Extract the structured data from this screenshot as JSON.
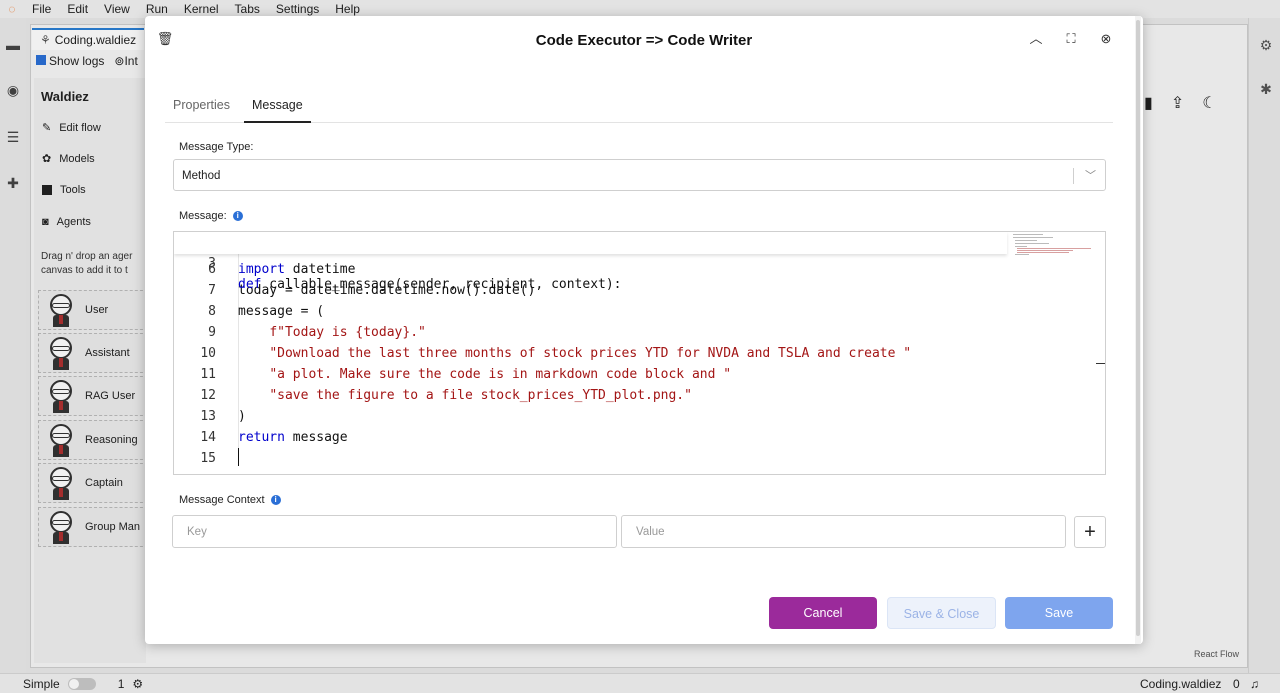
{
  "menubar": {
    "items": [
      "File",
      "Edit",
      "View",
      "Run",
      "Kernel",
      "Tabs",
      "Settings",
      "Help"
    ]
  },
  "left_bar_icons": [
    "folder-icon",
    "stop-circle-icon",
    "list-icon",
    "puzzle-icon"
  ],
  "right_bar_icons": [
    "gear-icon",
    "bug-icon"
  ],
  "doc": {
    "tab_label": "Coding.waldiez",
    "show_logs": "Show logs",
    "interrupt": "Int",
    "sidebar": {
      "title": "Waldiez",
      "nav": [
        {
          "label": "Edit flow",
          "icon": "edit-icon"
        },
        {
          "label": "Models",
          "icon": "openai-icon"
        },
        {
          "label": "Tools",
          "icon": "terminal-icon"
        },
        {
          "label": "Agents",
          "icon": "robot-icon"
        }
      ],
      "hint_line1": "Drag n' drop an ager",
      "hint_line2": "canvas to add it to t",
      "agents": [
        "User",
        "Assistant",
        "RAG User",
        "Reasoning",
        "Captain",
        "Group Man"
      ]
    },
    "react_flow": "React Flow"
  },
  "statusbar": {
    "mode": "Simple",
    "count": "1",
    "filename": "Coding.waldiez",
    "errors": "0"
  },
  "modal": {
    "title": "Code Executor => Code Writer",
    "tabs": [
      {
        "label": "Properties"
      },
      {
        "label": "Message"
      }
    ],
    "message_type_label": "Message Type:",
    "message_type_value": "Method",
    "message_label": "Message:",
    "code_header": {
      "num": "3",
      "text": "def callable_message(sender, recipient, context):"
    },
    "code_lines": [
      {
        "num": "6",
        "text": "    import datetime"
      },
      {
        "num": "7",
        "text": "    today = datetime.datetime.now().date()"
      },
      {
        "num": "8",
        "text": "    message = ("
      },
      {
        "num": "9",
        "text": "        f\"Today is {today}.\""
      },
      {
        "num": "10",
        "text": "        \"Download the last three months of stock prices YTD for NVDA and TSLA and create \""
      },
      {
        "num": "11",
        "text": "        \"a plot. Make sure the code is in markdown code block and \""
      },
      {
        "num": "12",
        "text": "        \"save the figure to a file stock_prices_YTD_plot.png.\""
      },
      {
        "num": "13",
        "text": "    )"
      },
      {
        "num": "14",
        "text": "    return message"
      },
      {
        "num": "15",
        "text": ""
      }
    ],
    "context_label": "Message Context",
    "key_placeholder": "Key",
    "value_placeholder": "Value",
    "add_label": "+",
    "buttons": {
      "cancel": "Cancel",
      "save_close": "Save & Close",
      "save": "Save"
    }
  },
  "colors": {
    "cancel_bg": "#9b2a9b",
    "save_bg": "#7ea5ee",
    "keyword": "#0000cc",
    "string": "#a31515",
    "active_tab_accent": "#2a7fd4"
  }
}
